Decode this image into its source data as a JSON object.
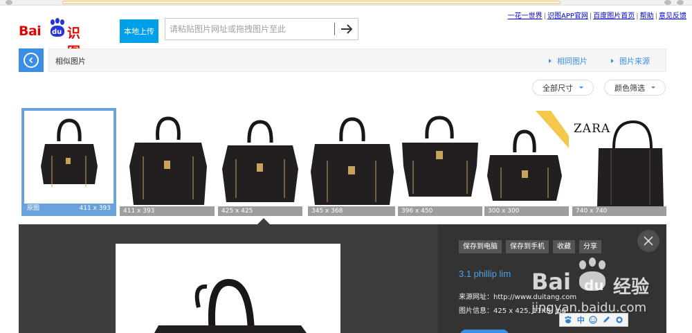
{
  "header": {
    "toplinks": [
      "一花一世界",
      "识图APP官网",
      "百度图片首页",
      "帮助",
      "意见反馈"
    ],
    "logo_text_en": "Bai",
    "logo_text_du": "du",
    "logo_text_cn": "识图",
    "upload_label": "本地上传",
    "search_placeholder": "请粘贴图片网址或拖拽图片至此"
  },
  "nav": {
    "title": "相似图片",
    "links": [
      "相同图片",
      "图片来源"
    ]
  },
  "filters": {
    "size_label": "全部尺寸",
    "color_label": "颜色筛选"
  },
  "thumbnails": [
    {
      "label": "原图",
      "size": "411 x 393"
    },
    {
      "label": "411 x 393"
    },
    {
      "label": "425 x 425"
    },
    {
      "label": "345 x 368"
    },
    {
      "label": "396 x 450"
    },
    {
      "label": "300 x 300"
    },
    {
      "label": "740 x 740"
    }
  ],
  "zara_text": "ZARA",
  "detail": {
    "actions": [
      "保存到电脑",
      "保存到手机",
      "收藏",
      "分享"
    ],
    "name": "3.1 phillip lim",
    "source_label": "来源网址：",
    "source_value": "http://www.duitang.com",
    "info_label": "图片信息：",
    "info_value": "425 x 425, 11KB, jpg"
  },
  "watermark": {
    "brand_en": "Bai",
    "brand_du": "du",
    "brand_cn": "经验",
    "url": "jingyan.baidu.com"
  },
  "ime": [
    "中"
  ],
  "colors": {
    "accent": "#3a8ee6",
    "upload": "#00a0e9",
    "logo_red": "#e10602",
    "logo_blue": "#2932e1",
    "dark_panel": "#3d3d3d"
  }
}
